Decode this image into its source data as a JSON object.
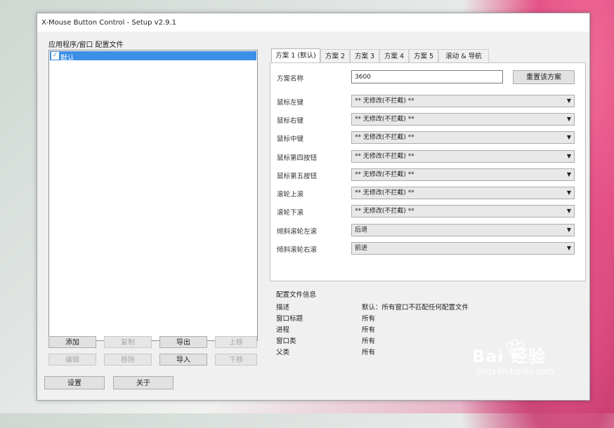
{
  "window": {
    "title": "X-Mouse Button Control - Setup v2.9.1"
  },
  "left": {
    "section_label": "应用程序/窗口 配置文件",
    "profiles": [
      {
        "label": "默认",
        "checked": true
      }
    ],
    "buttons": {
      "add": "添加",
      "copy": "复制",
      "export": "导出",
      "up": "上移",
      "edit": "编辑",
      "remove": "移除",
      "import": "导入",
      "down": "下移"
    }
  },
  "bottom": {
    "settings": "设置",
    "about": "关于"
  },
  "tabs": [
    {
      "label": "方案 1 (默认)",
      "active": true
    },
    {
      "label": "方案 2"
    },
    {
      "label": "方案 3"
    },
    {
      "label": "方案 4"
    },
    {
      "label": "方案 5"
    },
    {
      "label": "滚动 & 导航"
    }
  ],
  "scheme": {
    "name_label": "方案名称",
    "name_value": "3600",
    "reset_button": "重置该方案",
    "rows": [
      {
        "label": "鼠标左键",
        "value": "** 无修改(不拦截) **"
      },
      {
        "label": "鼠标右键",
        "value": "** 无修改(不拦截) **"
      },
      {
        "label": "鼠标中键",
        "value": "** 无修改(不拦截) **"
      },
      {
        "label": "鼠标第四按钮",
        "value": "** 无修改(不拦截) **"
      },
      {
        "label": "鼠标第五按钮",
        "value": "** 无修改(不拦截) **"
      },
      {
        "label": "滚轮上滚",
        "value": "** 无修改(不拦截) **"
      },
      {
        "label": "滚轮下滚",
        "value": "** 无修改(不拦截) **"
      },
      {
        "label": "倾斜滚轮左滚",
        "value": "后退"
      },
      {
        "label": "倾斜滚轮右滚",
        "value": "前进"
      }
    ]
  },
  "profile_info": {
    "title": "配置文件信息",
    "rows": [
      {
        "label": "描述",
        "value": "默认：所有窗口不匹配任何配置文件"
      },
      {
        "label": "窗口标题",
        "value": "所有"
      },
      {
        "label": "进程",
        "value": "所有"
      },
      {
        "label": "窗口类",
        "value": "所有"
      },
      {
        "label": "父类",
        "value": "所有"
      }
    ]
  },
  "watermark": {
    "brand": "Bai 经验",
    "url": "jingyan.baidu.com"
  }
}
